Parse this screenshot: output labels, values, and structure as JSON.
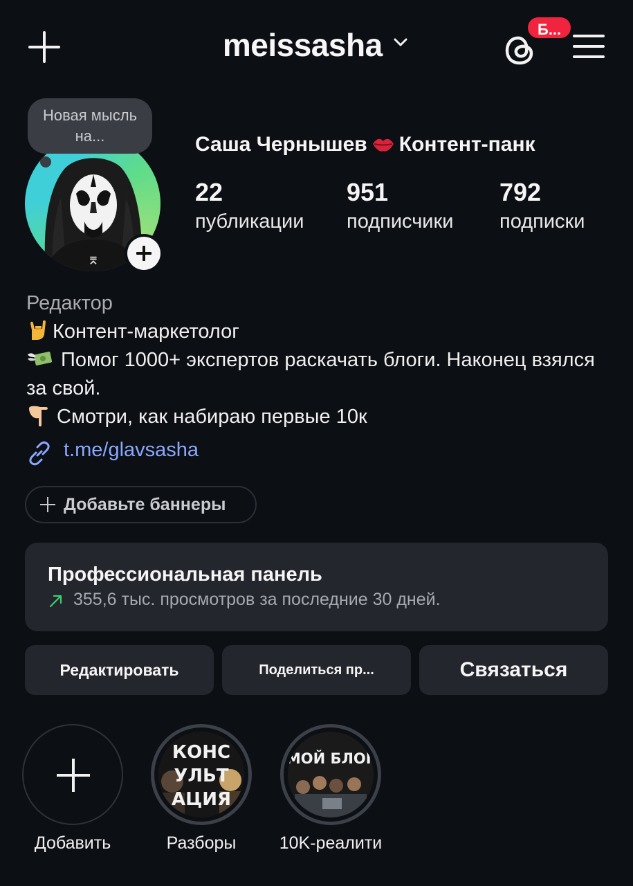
{
  "header": {
    "username": "meissasha",
    "threads_badge": "Б..."
  },
  "profile": {
    "note": "Новая мысль на...",
    "full_name": "Саша Чернышев",
    "category_suffix": "Контент-панк",
    "stats": [
      {
        "value": "22",
        "label": "публикации"
      },
      {
        "value": "951",
        "label": "подписчики"
      },
      {
        "value": "792",
        "label": "подписки"
      }
    ]
  },
  "bio": {
    "category": "Редактор",
    "line1": "Контент-маркетолог",
    "line2": "Помог 1000+ экспертов раскачать блоги. Наконец взялся за свой.",
    "line3": "Смотри, как набираю первые 10к",
    "link": "t.me/glavsasha"
  },
  "banner": {
    "label": "Добавьте баннеры"
  },
  "pro_panel": {
    "title": "Профессиональная панель",
    "subtitle": "355,6 тыс. просмотров за последние 30 дней."
  },
  "actions": {
    "edit": "Редактировать",
    "share": "Поделиться пр...",
    "contact": "Связаться"
  },
  "highlights": [
    {
      "label": "Добавить"
    },
    {
      "label": "Разборы",
      "cover_text": [
        "КОНС",
        "УЛЬТ",
        "АЦИЯ"
      ]
    },
    {
      "label": "10K-реалити",
      "cover_text": [
        "МОЙ БЛОГ"
      ]
    }
  ],
  "colors": {
    "background": "#0c0f14",
    "card": "#23262d",
    "link": "#8aa8ff",
    "badge": "#f0243e",
    "trend_up": "#3ecf6a"
  }
}
